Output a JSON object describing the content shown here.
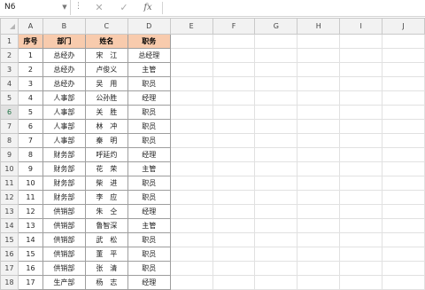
{
  "formula_bar": {
    "name_box": "N6",
    "cancel_icon": "✕",
    "confirm_icon": "✓",
    "fx_label": "fx",
    "formula_value": ""
  },
  "columns": [
    "A",
    "B",
    "C",
    "D",
    "E",
    "F",
    "G",
    "H",
    "I",
    "J"
  ],
  "header_row": [
    "序号",
    "部门",
    "姓名",
    "职务"
  ],
  "rows": [
    {
      "no": "1",
      "dept": "总经办",
      "name": "宋　江",
      "title": "总经理"
    },
    {
      "no": "2",
      "dept": "总经办",
      "name": "卢俊义",
      "title": "主管"
    },
    {
      "no": "3",
      "dept": "总经办",
      "name": "吴　用",
      "title": "职员"
    },
    {
      "no": "4",
      "dept": "人事部",
      "name": "公孙胜",
      "title": "经理"
    },
    {
      "no": "5",
      "dept": "人事部",
      "name": "关　胜",
      "title": "职员"
    },
    {
      "no": "6",
      "dept": "人事部",
      "name": "林　冲",
      "title": "职员"
    },
    {
      "no": "7",
      "dept": "人事部",
      "name": "秦　明",
      "title": "职员"
    },
    {
      "no": "8",
      "dept": "财务部",
      "name": "呼延灼",
      "title": "经理"
    },
    {
      "no": "9",
      "dept": "财务部",
      "name": "花　荣",
      "title": "主管"
    },
    {
      "no": "10",
      "dept": "财务部",
      "name": "柴　进",
      "title": "职员"
    },
    {
      "no": "11",
      "dept": "财务部",
      "name": "李　应",
      "title": "职员"
    },
    {
      "no": "12",
      "dept": "供销部",
      "name": "朱　仝",
      "title": "经理"
    },
    {
      "no": "13",
      "dept": "供销部",
      "name": "鲁智深",
      "title": "主管"
    },
    {
      "no": "14",
      "dept": "供销部",
      "name": "武　松",
      "title": "职员"
    },
    {
      "no": "15",
      "dept": "供销部",
      "name": "董　平",
      "title": "职员"
    },
    {
      "no": "16",
      "dept": "供销部",
      "name": "张　清",
      "title": "职员"
    },
    {
      "no": "17",
      "dept": "生产部",
      "name": "杨　志",
      "title": "经理"
    }
  ],
  "row_numbers": [
    "1",
    "2",
    "3",
    "4",
    "5",
    "6",
    "7",
    "8",
    "9",
    "10",
    "11",
    "12",
    "13",
    "14",
    "15",
    "16",
    "17",
    "18"
  ],
  "selected_row": "6",
  "colors": {
    "header_fill": "#f8cbad",
    "accent": "#217346"
  }
}
